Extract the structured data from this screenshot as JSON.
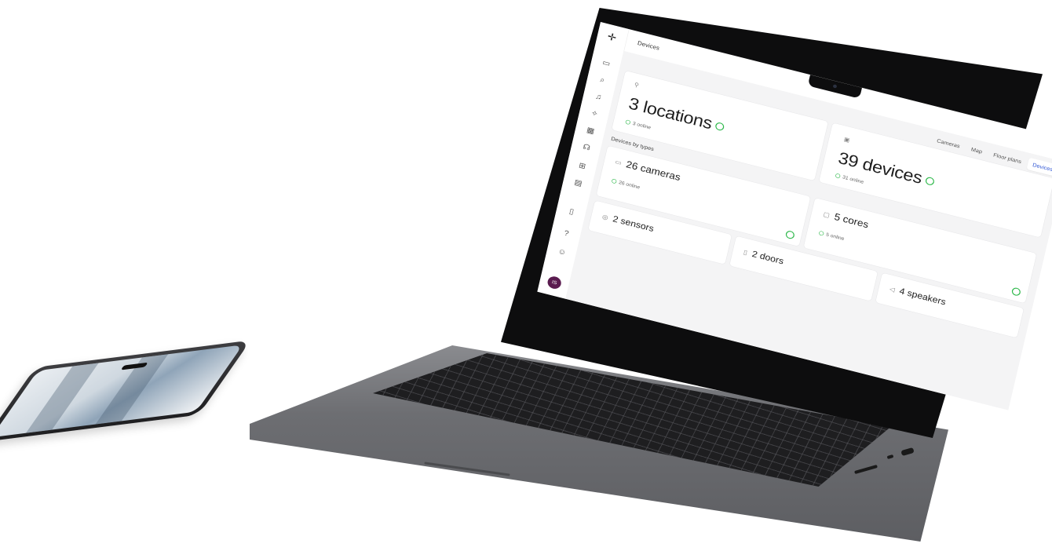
{
  "app": {
    "breadcrumb": "Devices",
    "avatar_initials": "IS",
    "accent_color": "#2f55d4",
    "online_color": "#2db84a",
    "avatar_color": "#5a1b4f"
  },
  "sidebar": {
    "items": [
      {
        "icon": "video-camera-icon",
        "glyph": "▭"
      },
      {
        "icon": "search-icon",
        "glyph": "⌕"
      },
      {
        "icon": "bell-icon",
        "glyph": "♫"
      },
      {
        "icon": "spark-icon",
        "glyph": "✧"
      },
      {
        "icon": "grid-icon",
        "glyph": "▦"
      },
      {
        "icon": "headset-icon",
        "glyph": "☊"
      },
      {
        "icon": "plus-box-icon",
        "glyph": "⊞"
      },
      {
        "icon": "table-icon",
        "glyph": "▤"
      },
      {
        "icon": "badge-icon",
        "glyph": "▯"
      },
      {
        "icon": "help-icon",
        "glyph": "?"
      },
      {
        "icon": "user-icon",
        "glyph": "☺"
      }
    ]
  },
  "tabs": [
    {
      "label": "Cameras",
      "active": false
    },
    {
      "label": "Map",
      "active": false
    },
    {
      "label": "Floor plans",
      "active": false
    },
    {
      "label": "Devices",
      "active": true
    }
  ],
  "summary": {
    "locations": {
      "label": "3 locations",
      "online": "3 online",
      "icon": "pin-icon"
    },
    "devices": {
      "label": "39 devices",
      "online": "31 online",
      "icon": "device-icon"
    }
  },
  "types_section_title": "Devices by types",
  "types": {
    "cameras": {
      "label": "26 cameras",
      "online": "26 online"
    },
    "cores": {
      "label": "5 cores",
      "online": "5 online"
    },
    "sensors": {
      "label": "2 sensors"
    },
    "doors": {
      "label": "2 doors"
    },
    "speakers": {
      "label": "4 speakers"
    }
  }
}
